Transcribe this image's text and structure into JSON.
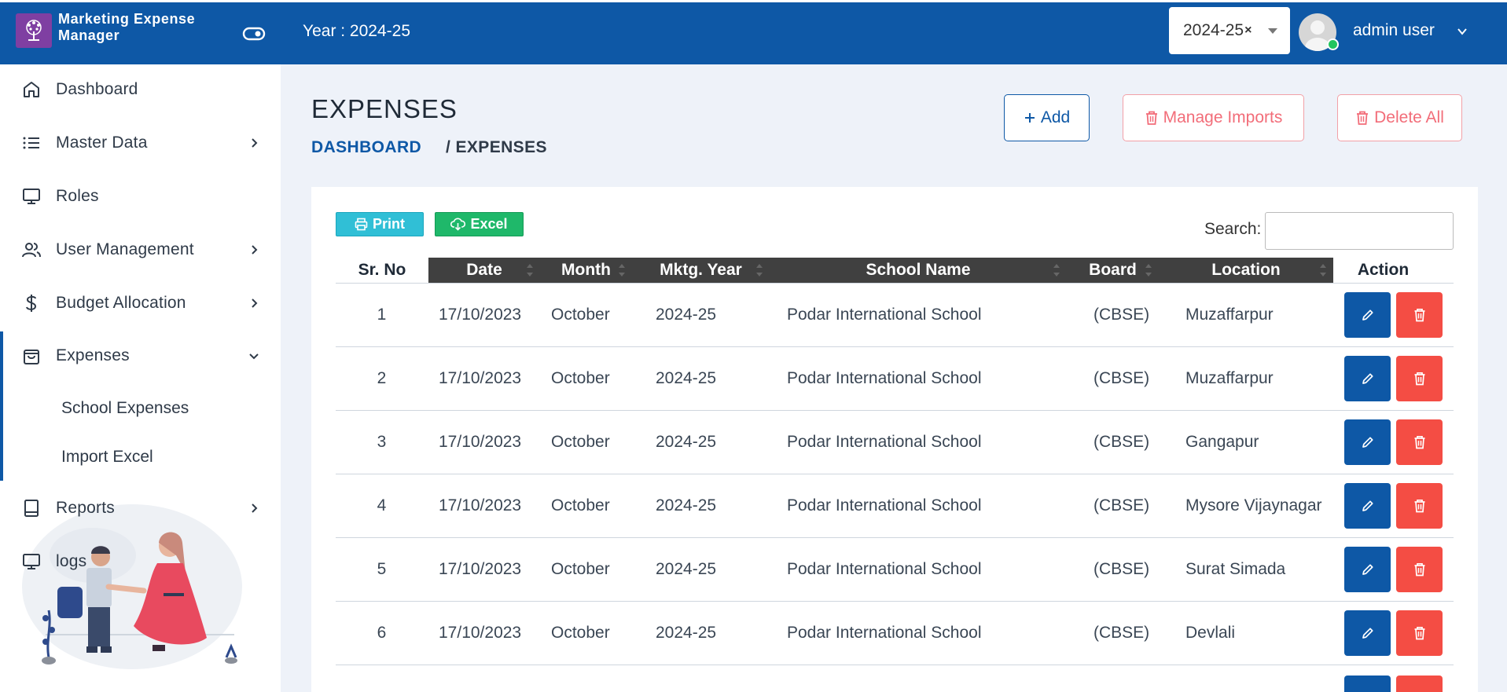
{
  "header": {
    "app_name": "Marketing Expense Manager",
    "year_label": "Year : 2024-25",
    "year_select_value": "2024-25",
    "year_clear": "×",
    "user_name": "admin user"
  },
  "sidebar": {
    "items": [
      {
        "label": "Dashboard",
        "icon": "home-icon"
      },
      {
        "label": "Master Data",
        "icon": "list-icon"
      },
      {
        "label": "Roles",
        "icon": "monitor-icon"
      },
      {
        "label": "User Management",
        "icon": "users-icon"
      },
      {
        "label": "Budget Allocation",
        "icon": "dollar-icon"
      },
      {
        "label": "Expenses",
        "icon": "shopping-bag-icon"
      },
      {
        "label": "Reports",
        "icon": "book-icon"
      },
      {
        "label": "logs",
        "icon": "monitor-icon"
      }
    ],
    "subitems": [
      "School Expenses",
      "Import Excel"
    ]
  },
  "page": {
    "title": "EXPENSES",
    "breadcrumb_home": "DASHBOARD",
    "breadcrumb_current": "/ EXPENSES",
    "add_label": "Add",
    "manage_imports_label": "Manage Imports",
    "delete_all_label": "Delete All"
  },
  "toolbar": {
    "print_label": "Print",
    "excel_label": "Excel",
    "search_label": "Search:"
  },
  "table": {
    "columns": [
      "Sr. No",
      "Date",
      "Month",
      "Mktg. Year",
      "School Name",
      "Board",
      "Location",
      "Action"
    ],
    "rows": [
      {
        "sr": "1",
        "date": "17/10/2023",
        "month": "October",
        "year": "2024-25",
        "school": "Podar International School",
        "board": "(CBSE)",
        "location": "Muzaffarpur"
      },
      {
        "sr": "2",
        "date": "17/10/2023",
        "month": "October",
        "year": "2024-25",
        "school": "Podar International School",
        "board": "(CBSE)",
        "location": "Muzaffarpur"
      },
      {
        "sr": "3",
        "date": "17/10/2023",
        "month": "October",
        "year": "2024-25",
        "school": "Podar International School",
        "board": "(CBSE)",
        "location": "Gangapur"
      },
      {
        "sr": "4",
        "date": "17/10/2023",
        "month": "October",
        "year": "2024-25",
        "school": "Podar International School",
        "board": "(CBSE)",
        "location": "Mysore Vijaynagar"
      },
      {
        "sr": "5",
        "date": "17/10/2023",
        "month": "October",
        "year": "2024-25",
        "school": "Podar International School",
        "board": "(CBSE)",
        "location": "Surat Simada"
      },
      {
        "sr": "6",
        "date": "17/10/2023",
        "month": "October",
        "year": "2024-25",
        "school": "Podar International School",
        "board": "(CBSE)",
        "location": "Devlali"
      }
    ]
  },
  "colors": {
    "primary": "#0e58a6",
    "danger": "#f44d44",
    "danger_outline": "#f26d79",
    "print": "#30bfd6",
    "excel": "#1fb86a"
  }
}
